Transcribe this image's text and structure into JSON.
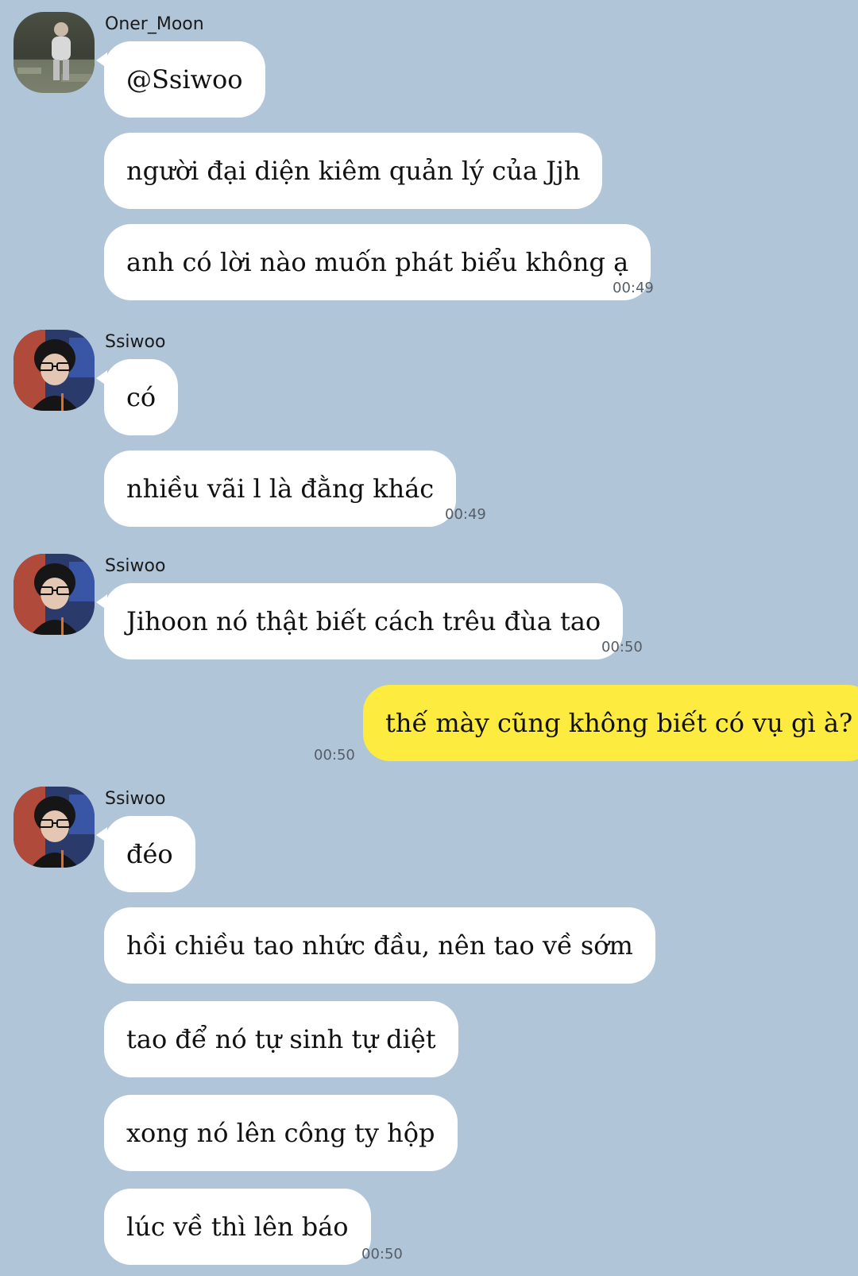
{
  "colors": {
    "background": "#b1c5d9",
    "incoming_bubble": "#ffffff",
    "outgoing_bubble": "#fdeb3f"
  },
  "messages": [
    {
      "sender": "Oner_Moon",
      "avatar": "photo-person-outdoors",
      "texts": [
        "@Ssiwoo",
        "người đại diện kiêm quản lý của Jjh",
        "anh có lời nào muốn phát biểu không ạ"
      ],
      "time": "00:49"
    },
    {
      "sender": "Ssiwoo",
      "avatar": "photo-person-glasses",
      "texts": [
        "có",
        "nhiều vãi l là đằng khác"
      ],
      "time": "00:49"
    },
    {
      "sender": "Ssiwoo",
      "avatar": "photo-person-glasses",
      "texts": [
        "Jihoon nó thật biết cách trêu đùa tao"
      ],
      "time": "00:50"
    },
    {
      "sender": "",
      "outgoing": true,
      "texts": [
        "thế mày cũng không biết có vụ gì à?"
      ],
      "time": "00:50"
    },
    {
      "sender": "Ssiwoo",
      "avatar": "photo-person-glasses",
      "texts": [
        "đéo",
        "hồi chiều tao nhức đầu, nên tao về sớm",
        "tao để nó tự sinh tự diệt",
        "xong nó lên công ty hộp",
        "lúc về thì lên báo"
      ],
      "time": "00:50"
    }
  ]
}
